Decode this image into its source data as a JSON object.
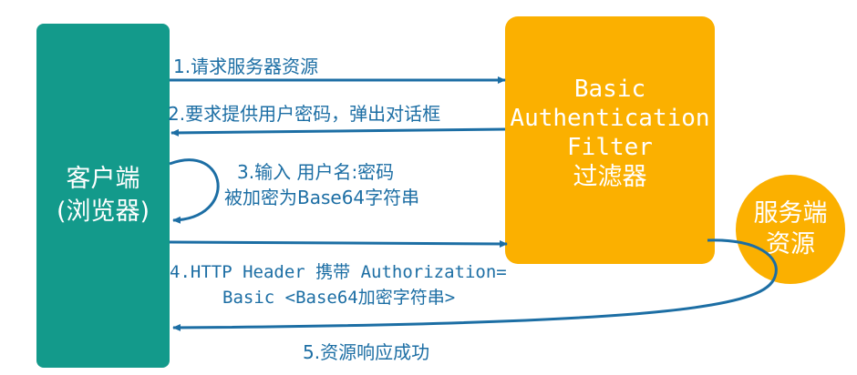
{
  "nodes": {
    "client": {
      "line1": "客户端",
      "line2": "(浏览器)"
    },
    "filter": {
      "line1": "Basic",
      "line2": "Authentication",
      "line3": "Filter",
      "line4": "过滤器"
    },
    "resource": {
      "line1": "服务端",
      "line2": "资源"
    }
  },
  "steps": {
    "s1": "1.请求服务器资源",
    "s2": "2.要求提供用户密码，弹出对话框",
    "s3_line1": "3.输入 用户名:密码",
    "s3_line2": "被加密为Base64字符串",
    "s4_line1": "4.HTTP Header 携带 Authorization=",
    "s4_line2": "Basic <Base64加密字符串>",
    "s5": "5.资源响应成功"
  },
  "colors": {
    "client": "#139a8b",
    "filter": "#fbb000",
    "resource": "#fbb000",
    "arrow": "#1c6ea4",
    "text": "#1c6ea4"
  }
}
